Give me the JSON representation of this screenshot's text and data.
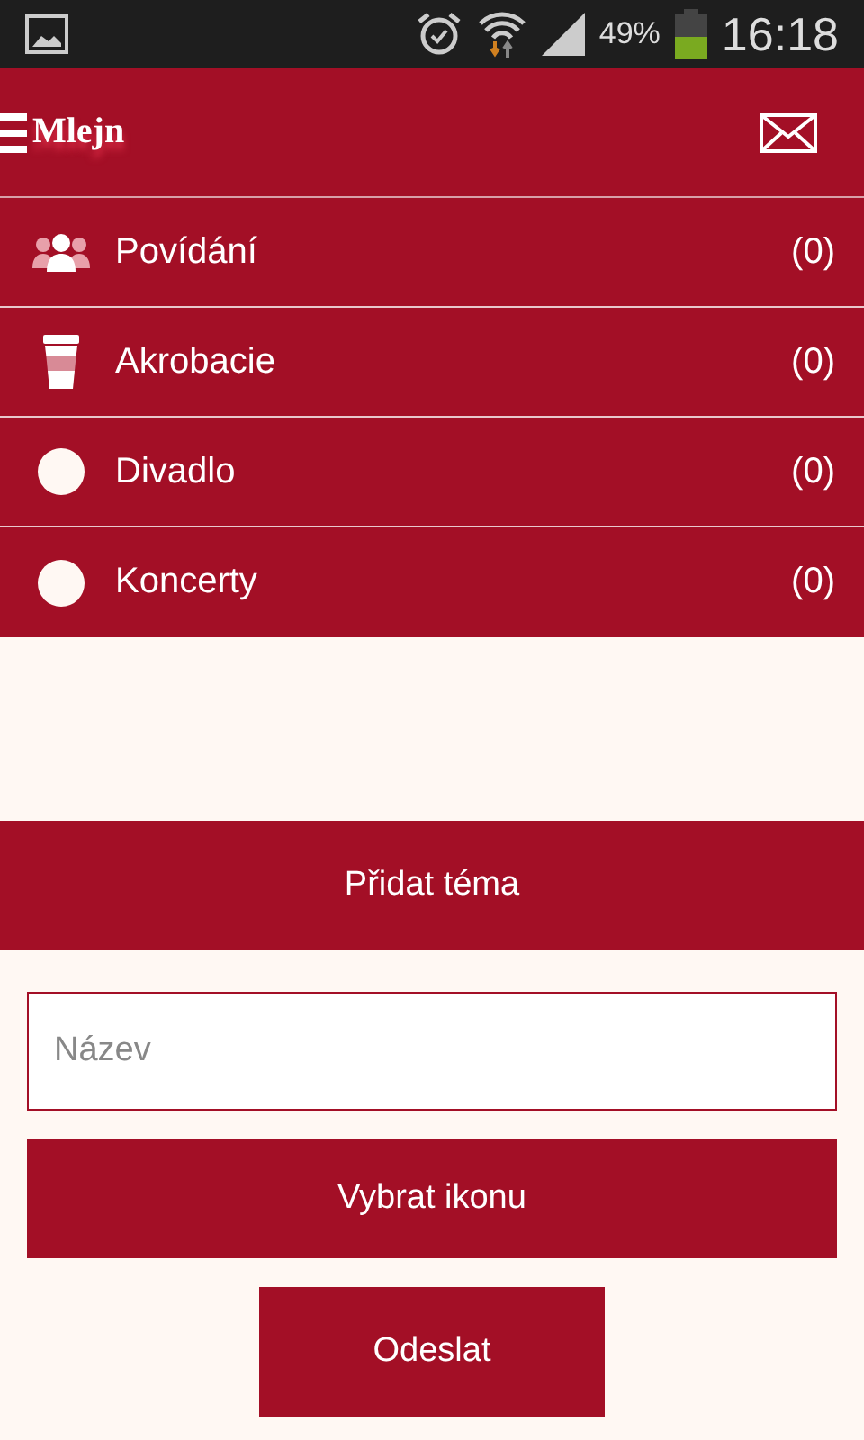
{
  "status_bar": {
    "battery": "49%",
    "time": "16:18"
  },
  "header": {
    "logo": "Mlejn"
  },
  "topics": [
    {
      "kind": "people",
      "name": "Povídání",
      "count": "(0)"
    },
    {
      "kind": "cup",
      "name": "Akrobacie",
      "count": "(0)"
    },
    {
      "kind": "circle",
      "name": "Divadlo",
      "count": "(0)"
    },
    {
      "kind": "circle",
      "name": "Koncerty",
      "count": "(0)"
    }
  ],
  "add_topic": {
    "title": "Přidat téma"
  },
  "form": {
    "name_placeholder": "Název",
    "icon_button": "Vybrat ikonu",
    "submit_button": "Odeslat"
  }
}
